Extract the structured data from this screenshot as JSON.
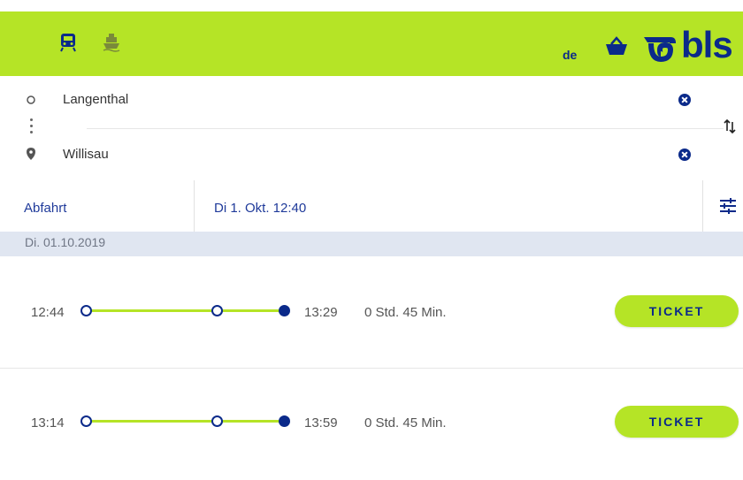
{
  "header": {
    "lang": "de",
    "logo_text": "bls",
    "icons": [
      "train-icon",
      "ship-icon",
      "basket-icon"
    ],
    "colors": {
      "green": "#b5e426",
      "navy": "#0b2a8a"
    }
  },
  "route": {
    "from": "Langenthal",
    "to": "Willisau"
  },
  "timebar": {
    "mode": "Abfahrt",
    "datetime": "Di 1. Okt. 12:40"
  },
  "date_band": "Di. 01.10.2019",
  "connections": [
    {
      "dep": "12:44",
      "arr": "13:29",
      "duration": "0 Std. 45 Min.",
      "ticket": "TICKET"
    },
    {
      "dep": "13:14",
      "arr": "13:59",
      "duration": "0 Std. 45 Min.",
      "ticket": "TICKET"
    }
  ]
}
